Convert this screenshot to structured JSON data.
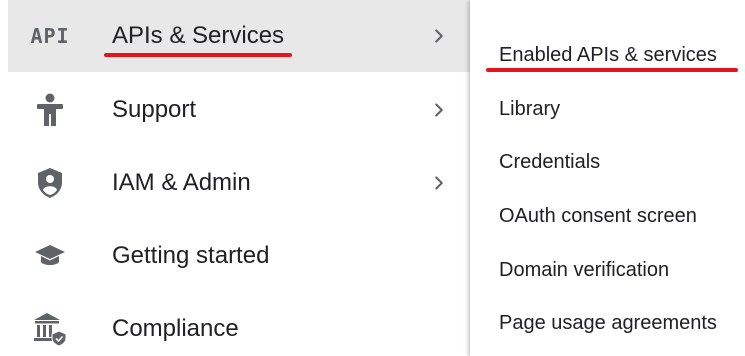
{
  "nav": {
    "items": [
      {
        "label": "APIs & Services",
        "icon": "api-icon",
        "icon_text": "API",
        "has_submenu": true,
        "active": true
      },
      {
        "label": "Support",
        "icon": "accessibility-person-icon",
        "has_submenu": true,
        "active": false
      },
      {
        "label": "IAM & Admin",
        "icon": "shield-person-icon",
        "has_submenu": true,
        "active": false
      },
      {
        "label": "Getting started",
        "icon": "graduation-cap-icon",
        "has_submenu": false,
        "active": false
      },
      {
        "label": "Compliance",
        "icon": "bank-shield-icon",
        "has_submenu": false,
        "active": false
      }
    ]
  },
  "submenu": {
    "items": [
      {
        "label": "Enabled APIs & services"
      },
      {
        "label": "Library"
      },
      {
        "label": "Credentials"
      },
      {
        "label": "OAuth consent screen"
      },
      {
        "label": "Domain verification"
      },
      {
        "label": "Page usage agreements"
      }
    ]
  },
  "colors": {
    "highlight_underline": "#e8141c",
    "active_row": "#e8e8e8",
    "icon": "#5f6368",
    "text": "#202124"
  }
}
